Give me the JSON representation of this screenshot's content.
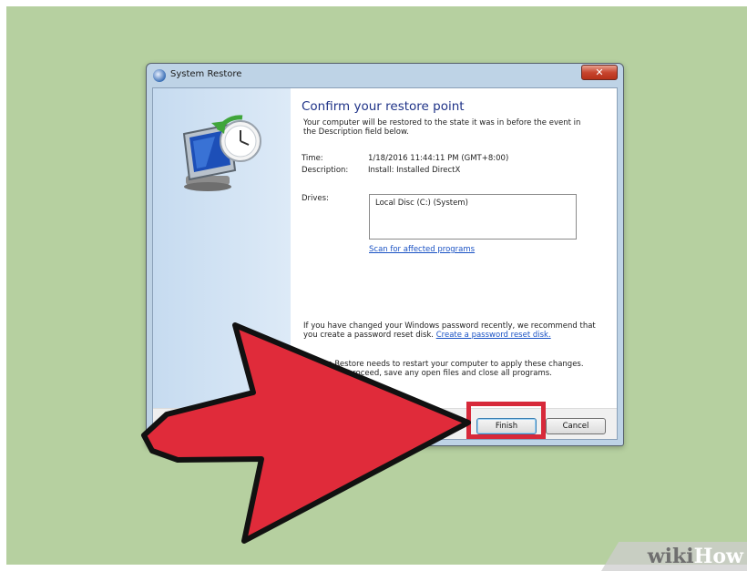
{
  "window": {
    "title": "System Restore",
    "close_glyph": "✕"
  },
  "content": {
    "heading": "Confirm your restore point",
    "intro": "Your computer will be restored to the state it was in before the event in the Description field below.",
    "time_label": "Time:",
    "time_value": "1/18/2016 11:44:11 PM (GMT+8:00)",
    "description_label": "Description:",
    "description_value": "Install: Installed DirectX",
    "drives_label": "Drives:",
    "drives_value": "Local Disc (C:) (System)",
    "scan_link": "Scan for affected programs",
    "password_text": "If you have changed your Windows password recently, we recommend that you create a password reset disk.",
    "password_link": "Create a password reset disk.",
    "restart_text": "System Restore needs to restart your computer to apply these changes. Before you proceed, save any open files and close all programs."
  },
  "buttons": {
    "finish": "Finish",
    "cancel": "Cancel"
  },
  "watermark": {
    "part1": "wiki",
    "part2": "How"
  },
  "colors": {
    "background": "#b6d0a0",
    "arrow_fill": "#e02b3a",
    "highlight": "#d7293a",
    "heading": "#1e3287",
    "link": "#1a52c4"
  },
  "icons": [
    "system-restore-icon",
    "pointer-arrow-icon",
    "close-icon"
  ]
}
